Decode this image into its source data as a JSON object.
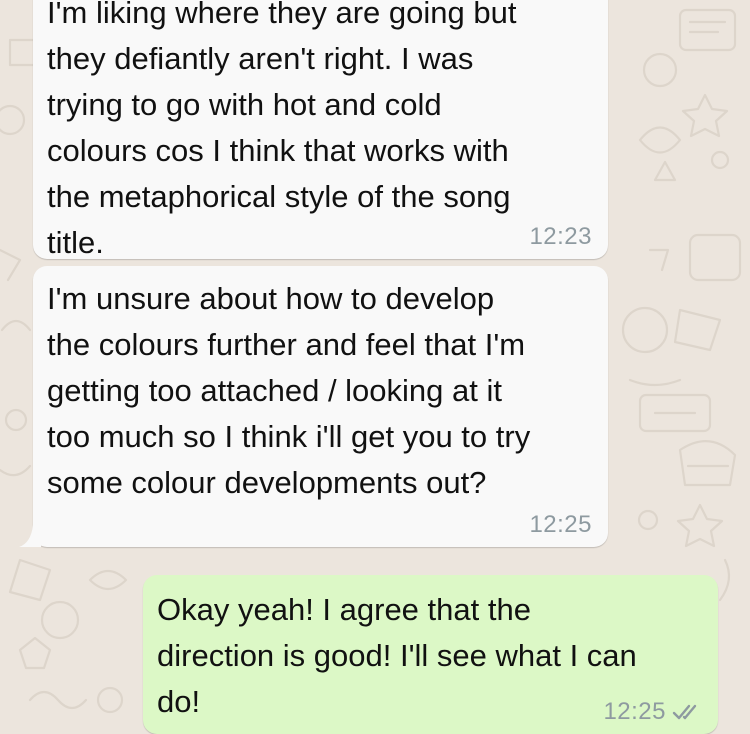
{
  "messages": [
    {
      "direction": "incoming",
      "text": "I'm liking where they are going but\nthey defiantly aren't right. I was\ntrying to go with hot and cold\ncolours cos I think that works with\nthe metaphorical style of the song\ntitle.",
      "time": "12:23"
    },
    {
      "direction": "incoming",
      "text": "I'm unsure about how to develop\nthe colours further and feel that I'm\ngetting too attached / looking at it\ntoo much so I think i'll get you to try\nsome colour developments out?",
      "time": "12:25"
    },
    {
      "direction": "outgoing",
      "text": "Okay yeah! I agree that the\ndirection is good! I'll see what I can\ndo!",
      "time": "12:25",
      "status_icon": "double-check-icon"
    }
  ],
  "colors": {
    "background": "#ece5dd",
    "incoming_bubble": "#f9f9f9",
    "outgoing_bubble": "#dcf8c6",
    "timestamp": "#8e9aa0"
  }
}
